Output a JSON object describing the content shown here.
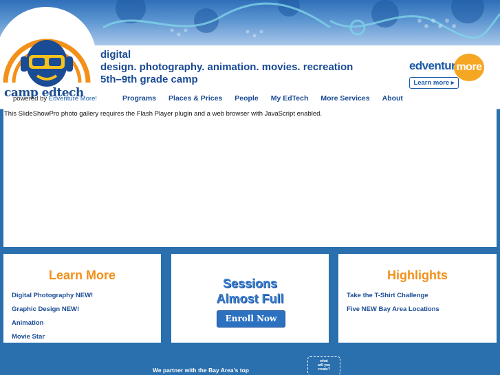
{
  "header": {
    "logo_text": "camp edtech",
    "powered_prefix": "powered by ",
    "powered_link": "Edventure More!",
    "tagline": [
      "digital",
      "design. photography. animation. movies. recreation",
      "5th–9th grade camp"
    ],
    "nav": [
      "Programs",
      "Places & Prices",
      "People",
      "My EdTech",
      "More Services",
      "About"
    ],
    "edventure_word": "edventure",
    "edventure_more": "more",
    "learn_more_button": "Learn more ▸"
  },
  "slideshow": {
    "notice": "This SlideShowPro photo gallery requires the Flash Player plugin and a web browser with JavaScript enabled."
  },
  "panels": {
    "learn_more": {
      "title": "Learn More",
      "links": [
        "Digital Photography NEW!",
        "Graphic Design NEW!",
        "Animation",
        "Movie Star"
      ]
    },
    "sessions": {
      "line1": "Sessions",
      "line2": "Almost Full",
      "button": "Enroll Now"
    },
    "highlights": {
      "title": "Highlights",
      "links": [
        "Take the T-Shirt Challenge",
        "Five NEW Bay Area Locations"
      ]
    }
  },
  "footer": {
    "partner_text": "We partner with the Bay Area's top",
    "badge_lines": [
      "what",
      "will you",
      "create?"
    ]
  },
  "colors": {
    "brand_blue": "#1a4b95",
    "accent_orange": "#f39019",
    "page_bg": "#2a6fae"
  }
}
